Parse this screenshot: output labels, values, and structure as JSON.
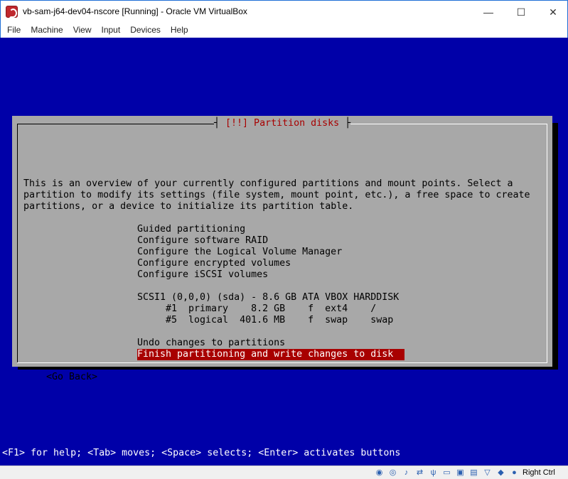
{
  "window": {
    "title": "vb-sam-j64-dev04-nscore [Running] - Oracle VM VirtualBox",
    "min_symbol": "—",
    "max_symbol": "☐",
    "close_symbol": "✕"
  },
  "menu": [
    "File",
    "Machine",
    "View",
    "Input",
    "Devices",
    "Help"
  ],
  "dialog": {
    "title": "[!!] Partition disks",
    "title_bar_left": "┤",
    "title_bar_right": "├",
    "intro": [
      "This is an overview of your currently configured partitions and mount points. Select a",
      "partition to modify its settings (file system, mount point, etc.), a free space to create",
      "partitions, or a device to initialize its partition table."
    ],
    "options": [
      "Guided partitioning",
      "Configure software RAID",
      "Configure the Logical Volume Manager",
      "Configure encrypted volumes",
      "Configure iSCSI volumes"
    ],
    "disk": "SCSI1 (0,0,0) (sda) - 8.6 GB ATA VBOX HARDDISK",
    "partitions": [
      "#1  primary    8.2 GB    f  ext4    /",
      "#5  logical  401.6 MB    f  swap    swap"
    ],
    "undo": "Undo changes to partitions",
    "finish": "Finish partitioning and write changes to disk",
    "go_back": "<Go Back>"
  },
  "help_line": "<F1> for help; <Tab> moves; <Space> selects; <Enter> activates buttons",
  "statusbar": {
    "icons": [
      "harddisk-icon",
      "optical-disc-icon",
      "audio-icon",
      "network-icon",
      "usb-icon",
      "shared-folder-icon",
      "display-icon",
      "screen-icon",
      "video-capture-icon",
      "cpu-icon",
      "mouse-integration-icon",
      "arrow-icon"
    ],
    "host_key": "Right Ctrl"
  },
  "colors": {
    "screen_bg": "#0000a8",
    "dialog_bg": "#a8a8a8",
    "title_red": "#a80000",
    "selection_bg": "#a80000"
  }
}
